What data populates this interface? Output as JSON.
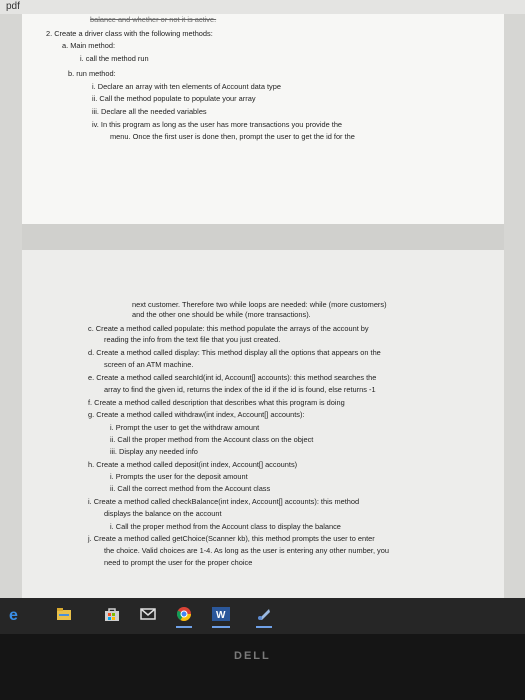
{
  "window": {
    "title": "pdf"
  },
  "page1": {
    "cutoff_line": "balance and whether or not it is active.",
    "lines": [
      "2.   Create a driver class with the following methods:",
      "a.   Main method:",
      "i.   call the method run",
      "b.   run method:",
      "i.   Declare an array with ten elements of Account data type",
      "ii.   Call the method populate to populate your array",
      "iii.   Declare all the needed variables",
      "iv.   In this program as long as the user has more transactions you provide the",
      "menu. Once the first user is done then, prompt the user to get the id for the"
    ]
  },
  "page2": {
    "lines": [
      "next customer. Therefore two while loops are needed: while (more customers)",
      "and the other one should be while (more transactions).",
      "c.   Create a method called populate: this method populate the arrays of the account by",
      "reading the info from the text file that you just created.",
      "d.   Create a method called display: This method display all the options that appears on the",
      "screen of an ATM machine.",
      "e.   Create a method called searchId(int id, Account[] accounts): this method searches the",
      "array to find the given id, returns the index of the id if the id is found, else returns -1",
      "f.   Create a method called description that describes what this program is doing",
      "g.   Create a method called withdraw(int index, Account[] accounts):",
      "i.   Prompt the user to get the withdraw amount",
      "ii.   Call the proper method from the Account class on the object",
      "iii.   Display any needed info",
      "h.   Create a method called deposit(int index, Account[] accounts)",
      "i.   Prompts the user for the deposit amount",
      "ii.   Call the correct method from the Account class",
      "i.   Create a method called checkBalance(int index, Account[] accounts): this method",
      "displays the balance on the account",
      "i.   Call the proper method from the Account class to display the balance",
      "j.   Create a method called getChoice(Scanner kb), this method prompts the user to enter",
      "the choice. Valid choices are 1-4. As long as the user is entering any other number, you",
      "need to prompt the user for the proper choice"
    ]
  },
  "taskbar": {
    "icons": [
      "edge-icon",
      "file-explorer-icon",
      "store-icon",
      "mail-icon",
      "chrome-icon",
      "word-icon",
      "snipping-tool-icon"
    ],
    "word_label": "W",
    "accent": "#6fa0e6"
  },
  "bezel": {
    "logo": "DELL"
  }
}
